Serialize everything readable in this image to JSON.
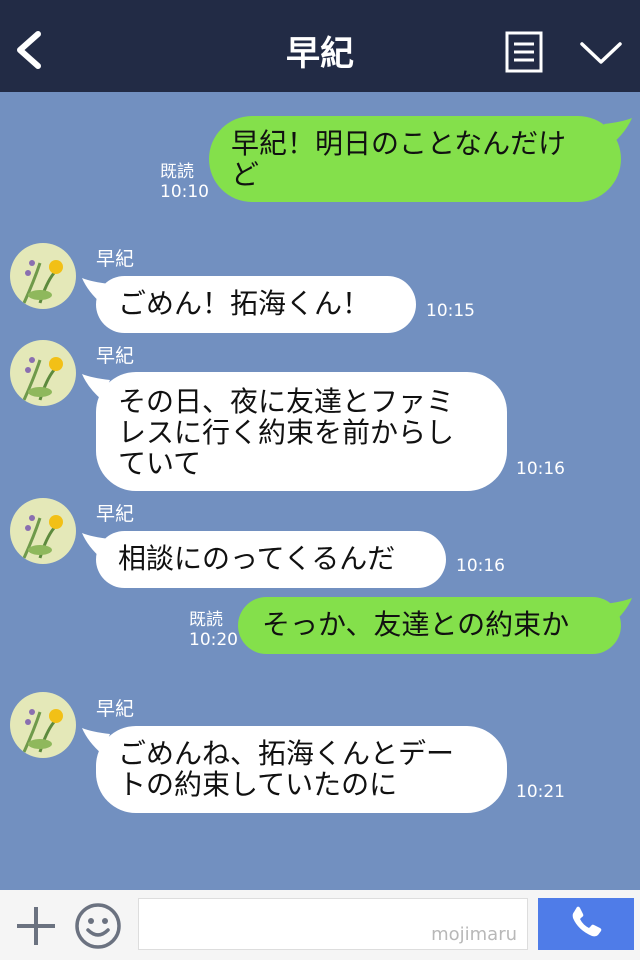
{
  "header": {
    "title": "早紀",
    "back_icon": "chevron-left-icon",
    "notes_icon": "note-list-icon",
    "menu_icon": "chevron-down-icon"
  },
  "messages": [
    {
      "side": "right",
      "lines": [
        "早紀！明日のことなんだけ",
        "ど"
      ],
      "read": "既読",
      "time": "10:10"
    },
    {
      "side": "left",
      "sender": "早紀",
      "lines": [
        "ごめん！拓海くん！"
      ],
      "time": "10:15"
    },
    {
      "side": "left",
      "sender": "早紀",
      "lines": [
        "その日、夜に友達とファミ",
        "レスに行く約束を前からし",
        "ていて"
      ],
      "time": "10:16"
    },
    {
      "side": "left",
      "sender": "早紀",
      "lines": [
        "相談にのってくるんだ"
      ],
      "time": "10:16"
    },
    {
      "side": "right",
      "lines": [
        "そっか、友達との約束か"
      ],
      "read": "既読",
      "time": "10:20"
    },
    {
      "side": "left",
      "sender": "早紀",
      "lines": [
        "ごめんね、拓海くんとデー",
        "トの約束していたのに"
      ],
      "time": "10:21"
    }
  ],
  "input": {
    "watermark": "mojimaru",
    "plus_icon": "plus-icon",
    "emoji_icon": "smiley-icon",
    "call_icon": "phone-icon"
  },
  "colors": {
    "header": "#222b45",
    "chat_bg": "#7290c0",
    "sent_bubble": "#84e04b",
    "received_bubble": "#ffffff",
    "call_button": "#4f7ce8"
  }
}
